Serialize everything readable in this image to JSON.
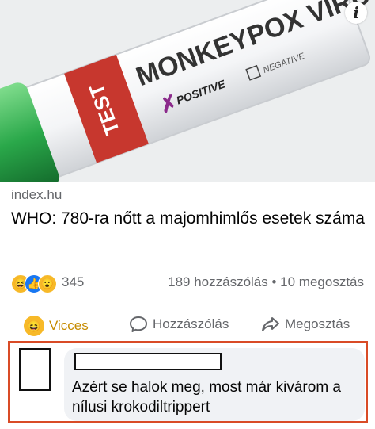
{
  "image": {
    "tube_label": "MONKEYPOX VIRUS",
    "tag_label": "TEST",
    "positive_label": "POSITIVE",
    "negative_label": "NEGATIVE",
    "icon": "info-icon",
    "info_glyph": "i"
  },
  "post": {
    "source": "index.hu",
    "headline": "WHO: 780-ra nőtt a majomhimlős esetek száma"
  },
  "stats": {
    "reaction_icons": [
      "haha-icon",
      "like-icon",
      "wow-icon"
    ],
    "reaction_count": "345",
    "comments_shares": "189 hozzászólás • 10 megosztás"
  },
  "actions": {
    "reaction_label": "Vicces",
    "reaction_icon": "laughing-emoji-icon",
    "comment_label": "Hozzászólás",
    "comment_icon": "comment-icon",
    "share_label": "Megosztás",
    "share_icon": "share-icon"
  },
  "comment": {
    "text": "Azért se halok meg, most már kivárom a nílusi krokodiltrippert"
  },
  "colors": {
    "highlight_border": "#d94b26",
    "bubble": "#f0f2f5",
    "tube_red": "#c7372e",
    "tube_green": "#2aa84a"
  }
}
